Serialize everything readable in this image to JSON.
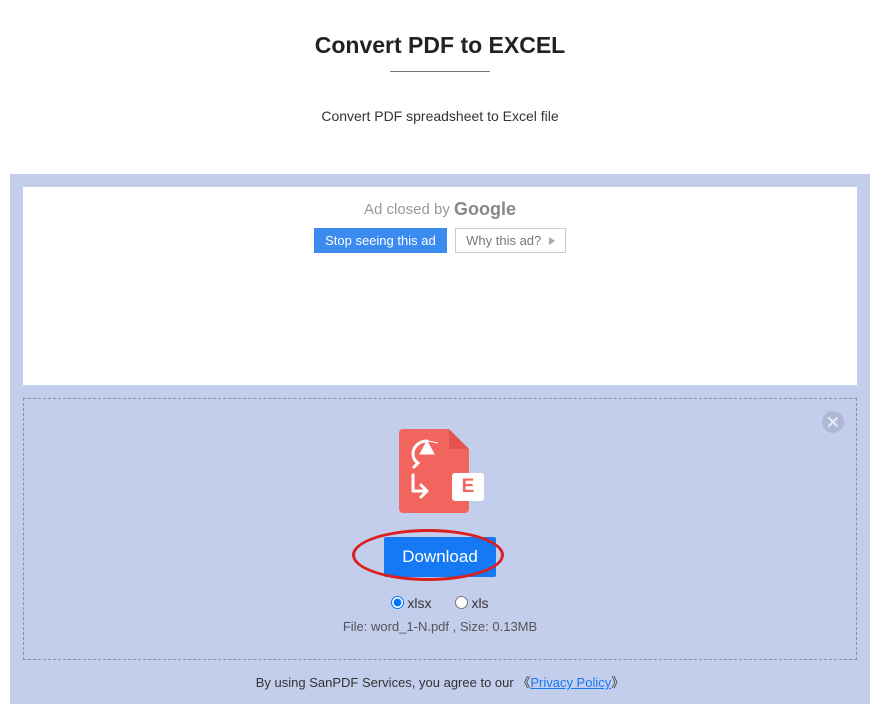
{
  "header": {
    "title": "Convert PDF to EXCEL",
    "subtitle": "Convert PDF spreadsheet to Excel file"
  },
  "ad": {
    "closed_prefix": "Ad closed by ",
    "google": "Google",
    "stop": "Stop seeing this ad",
    "why": "Why this ad?"
  },
  "dropzone": {
    "excel_letter": "E",
    "download": "Download",
    "format_xlsx": "xlsx",
    "format_xls": "xls",
    "file_info": "File: word_1-N.pdf , Size: 0.13MB"
  },
  "footer": {
    "text": "By using SanPDF Services, you agree to our ",
    "link": "Privacy Policy",
    "angle_l": "《",
    "angle_r": "》"
  }
}
